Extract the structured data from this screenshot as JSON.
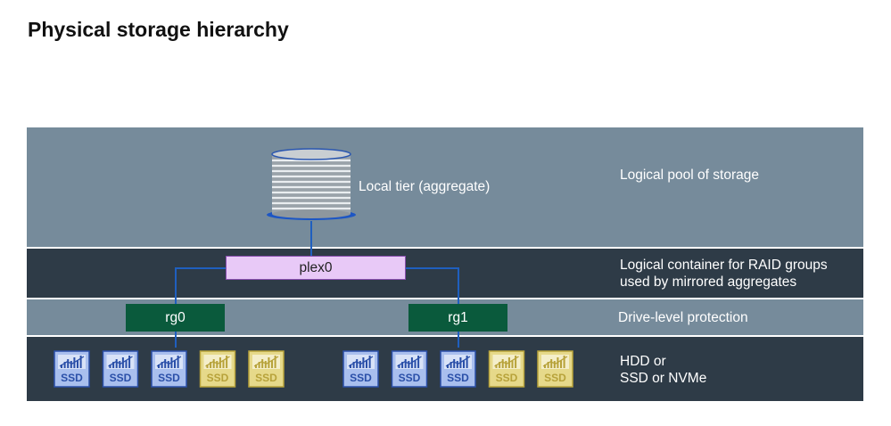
{
  "title": "Physical storage hierarchy",
  "aggregate": {
    "label": "Local tier (aggregate)"
  },
  "plex": {
    "label": "plex0"
  },
  "raid_groups": [
    {
      "label": "rg0"
    },
    {
      "label": "rg1"
    }
  ],
  "descriptions": {
    "pool": "Logical pool of storage",
    "container": [
      "Logical container for RAID groups",
      "used by mirrored aggregates"
    ],
    "protection": "Drive-level protection",
    "drives": [
      "HDD or",
      "SSD or NVMe"
    ]
  },
  "drive_groups": [
    {
      "drives": [
        {
          "label": "SSD",
          "style": "blue"
        },
        {
          "label": "SSD",
          "style": "blue"
        },
        {
          "label": "SSD",
          "style": "blue"
        },
        {
          "label": "SSD",
          "style": "yellow"
        },
        {
          "label": "SSD",
          "style": "yellow"
        }
      ]
    },
    {
      "drives": [
        {
          "label": "SSD",
          "style": "blue"
        },
        {
          "label": "SSD",
          "style": "blue"
        },
        {
          "label": "SSD",
          "style": "blue"
        },
        {
          "label": "SSD",
          "style": "yellow"
        },
        {
          "label": "SSD",
          "style": "yellow"
        }
      ]
    }
  ],
  "colors": {
    "band_light": "#768b9b",
    "band_dark": "#2e3b47",
    "plex_fill": "#e8c9f7",
    "rg_fill": "#0a5a3c",
    "connector": "#1f5fbf",
    "drive_blue": "#a9bfee",
    "drive_yellow": "#e6d98a"
  }
}
